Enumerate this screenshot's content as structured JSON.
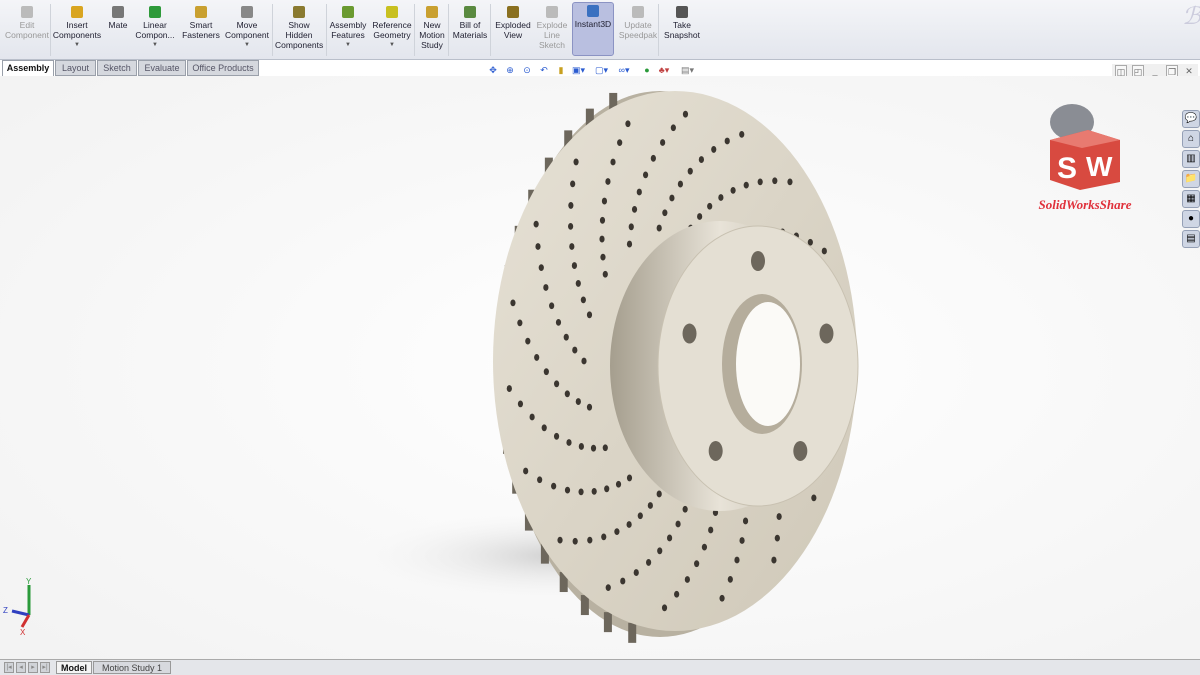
{
  "toolbar": {
    "items": [
      {
        "label": "Edit Component",
        "disabled": true
      },
      {
        "label": "Insert Components",
        "dropdown": true
      },
      {
        "label": "Mate"
      },
      {
        "label": "Linear Compon...",
        "dropdown": true
      },
      {
        "label": "Smart Fasteners"
      },
      {
        "label": "Move Component",
        "dropdown": true
      },
      {
        "label": "Show Hidden Components"
      },
      {
        "label": "Assembly Features",
        "dropdown": true
      },
      {
        "label": "Reference Geometry",
        "dropdown": true
      },
      {
        "label": "New Motion Study"
      },
      {
        "label": "Bill of Materials"
      },
      {
        "label": "Exploded View"
      },
      {
        "label": "Explode Line Sketch",
        "disabled": true
      },
      {
        "label": "Instant3D",
        "active": true
      },
      {
        "label": "Update Speedpak",
        "disabled": true
      },
      {
        "label": "Take Snapshot"
      }
    ]
  },
  "tabs": [
    "Assembly",
    "Layout",
    "Sketch",
    "Evaluate",
    "Office Products"
  ],
  "bottom_tabs": [
    "Model",
    "Motion Study 1"
  ],
  "triad": {
    "y": "Y",
    "z": "Z",
    "x": "X"
  },
  "watermark": {
    "letters": "SW",
    "caption": "SolidWorksShare"
  },
  "colors": {
    "accent": "#b9bfe0",
    "disc": "#d8d2c4",
    "logo": "#e0303a"
  }
}
